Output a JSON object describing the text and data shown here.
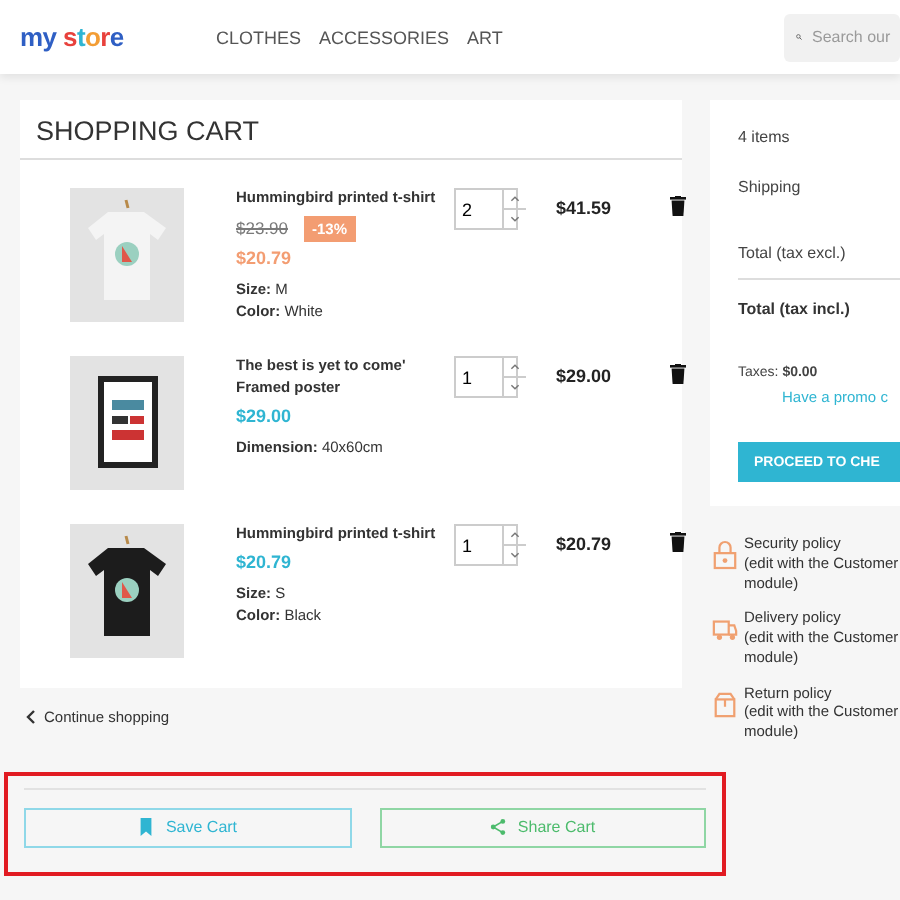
{
  "header": {
    "logo": "my store",
    "nav": [
      "CLOTHES",
      "ACCESSORIES",
      "ART"
    ],
    "search": {
      "placeholder": "Search our"
    }
  },
  "cart": {
    "title": "SHOPPING CART",
    "items": [
      {
        "name": "Hummingbird printed t-shirt",
        "regular_price": "$23.90",
        "discount": "-13%",
        "price": "$20.79",
        "on_sale": true,
        "attributes": [
          {
            "label": "Size:",
            "value": "M"
          },
          {
            "label": "Color:",
            "value": "White"
          }
        ],
        "quantity": "2",
        "total": "$41.59"
      },
      {
        "name": "The best is yet to come' Framed poster",
        "price": "$29.00",
        "on_sale": false,
        "attributes": [
          {
            "label": "Dimension:",
            "value": "40x60cm"
          }
        ],
        "quantity": "1",
        "total": "$29.00"
      },
      {
        "name": "Hummingbird printed t-shirt",
        "price": "$20.79",
        "on_sale": false,
        "attributes": [
          {
            "label": "Size:",
            "value": "S"
          },
          {
            "label": "Color:",
            "value": "Black"
          }
        ],
        "quantity": "1",
        "total": "$20.79"
      }
    ],
    "continue_link": "Continue shopping"
  },
  "summary": {
    "items_count": "4 items",
    "shipping": "Shipping",
    "total_excl": "Total (tax excl.)",
    "total_incl": "Total (tax incl.)",
    "taxes_label": "Taxes:",
    "taxes_value": "$0.00",
    "promo_link": "Have a promo c",
    "checkout_button": "PROCEED TO CHE"
  },
  "policies": [
    {
      "kind": "security",
      "title": "Security policy",
      "text": "(edit with the Customer module)"
    },
    {
      "kind": "delivery",
      "title": "Delivery policy",
      "text": "(edit with the Customer module)"
    },
    {
      "kind": "return",
      "title": "Return policy",
      "text": "(edit with the Customer module)"
    }
  ],
  "cart_actions": {
    "highlighted": true,
    "buttons": [
      {
        "kind": "save",
        "label": "Save Cart"
      },
      {
        "kind": "share",
        "label": "Share Cart"
      }
    ]
  }
}
